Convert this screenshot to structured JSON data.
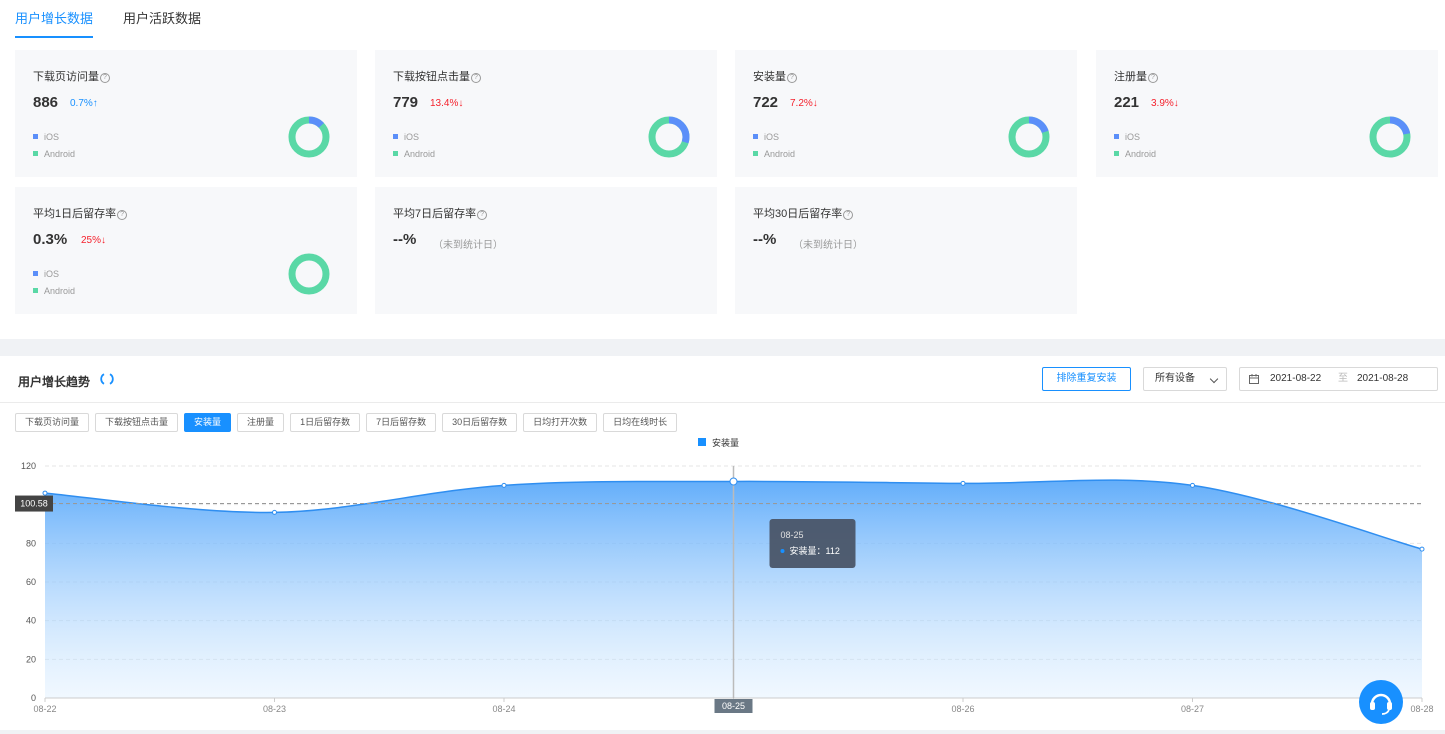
{
  "tabs": [
    {
      "label": "用户增长数据",
      "active": true
    },
    {
      "label": "用户活跃数据",
      "active": false
    }
  ],
  "help_glyph": "?",
  "legend": {
    "ios": "iOS",
    "android": "Android"
  },
  "colors": {
    "ios": "#5b8ff9",
    "android": "#5ad8a6",
    "accent": "#1890ff",
    "up": "#1890ff",
    "down": "#f5222d"
  },
  "cards": [
    {
      "title": "下载页访问量",
      "value": "886",
      "pct": "0.7%",
      "dir": "up",
      "arrow": "↑",
      "ios_share": 0.13
    },
    {
      "title": "下载按钮点击量",
      "value": "779",
      "pct": "13.4%",
      "dir": "down",
      "arrow": "↓",
      "ios_share": 0.3
    },
    {
      "title": "安装量",
      "value": "722",
      "pct": "7.2%",
      "dir": "down",
      "arrow": "↓",
      "ios_share": 0.2
    },
    {
      "title": "注册量",
      "value": "221",
      "pct": "3.9%",
      "dir": "down",
      "arrow": "↓",
      "ios_share": 0.22
    },
    {
      "title": "平均1日后留存率",
      "value": "0.3%",
      "pct": "25%",
      "dir": "down",
      "arrow": "↓",
      "ios_share": 0.0
    },
    {
      "title": "平均7日后留存率",
      "value": "--%",
      "note": "（未到统计日）"
    },
    {
      "title": "平均30日后留存率",
      "value": "--%",
      "note": "（未到统计日）"
    }
  ],
  "trend": {
    "title": "用户增长趋势",
    "dedupe_label": "排除重复安装",
    "device_select": "所有设备",
    "date_start": "2021-08-22",
    "date_sep": "至",
    "date_end": "2021-08-28",
    "metrics": [
      {
        "label": "下载页访问量",
        "active": false
      },
      {
        "label": "下载按钮点击量",
        "active": false
      },
      {
        "label": "安装量",
        "active": true
      },
      {
        "label": "注册量",
        "active": false
      },
      {
        "label": "1日后留存数",
        "active": false
      },
      {
        "label": "7日后留存数",
        "active": false
      },
      {
        "label": "30日后留存数",
        "active": false
      },
      {
        "label": "日均打开次数",
        "active": false
      },
      {
        "label": "日均在线时长",
        "active": false
      }
    ]
  },
  "chart_data": {
    "type": "area",
    "series": [
      {
        "name": "安装量",
        "values": [
          106,
          96,
          110,
          112,
          111,
          110,
          77
        ]
      }
    ],
    "x": [
      "08-22",
      "08-23",
      "08-24",
      "08-25",
      "08-26",
      "08-27",
      "08-28"
    ],
    "ylim": [
      0,
      120
    ],
    "yticks": [
      0,
      20,
      40,
      60,
      80,
      100,
      120
    ],
    "grid": true,
    "legend_position": "top-center",
    "average_line": {
      "value": 100.58,
      "label": "100.58"
    },
    "tooltip": {
      "x": "08-25",
      "label": "安装量",
      "value": "112",
      "sep": "："
    },
    "highlight_index": 3
  }
}
